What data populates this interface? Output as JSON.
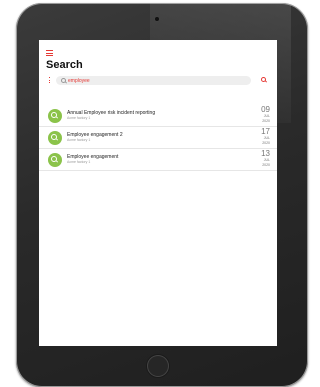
{
  "app": {
    "title": "Search"
  },
  "search": {
    "value": "employee",
    "placeholder": ""
  },
  "results": [
    {
      "title": "Annual Employee risk incident reporting",
      "subtitle": "Acme factory 1",
      "day": "09",
      "month": "JUL",
      "year": "2020"
    },
    {
      "title": "Employee engagement 2",
      "subtitle": "Acme factory 1",
      "day": "17",
      "month": "JUL",
      "year": "2020"
    },
    {
      "title": "Employee engagement",
      "subtitle": "Acme factory 1",
      "day": "13",
      "month": "JUL",
      "year": "2020"
    }
  ],
  "icons": {
    "menu": "hamburger-menu-icon",
    "filter": "more-vertical-icon",
    "search": "search-icon",
    "avatar": "search-icon"
  },
  "colors": {
    "accent": "#e53935",
    "avatar": "#8bc34a",
    "device": "#2a2a2a"
  }
}
